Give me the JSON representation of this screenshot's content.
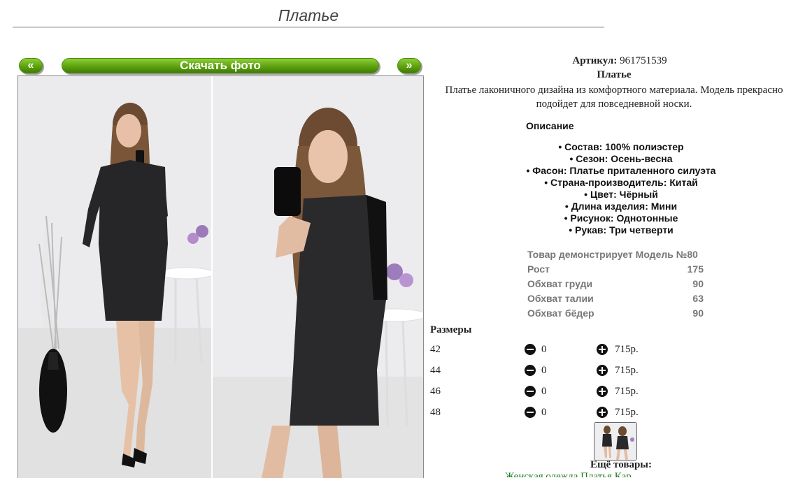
{
  "page": {
    "title": "Платье"
  },
  "gallery": {
    "prev_label": "«",
    "download_label": "Скачать фото",
    "next_label": "»"
  },
  "product": {
    "article_label": "Артикул:",
    "article_value": "961751539",
    "name": "Платье",
    "description": "Платье лаконичного дизайна из комфортного материала. Модель прекрасно подойдет для повседневной носки."
  },
  "specs": {
    "title": "Описание",
    "items": [
      "• Состав: 100% полиэстер",
      "• Сезон: Осень-весна",
      "• Фасон: Платье приталенного силуэта",
      "• Страна-производитель: Китай",
      "• Цвет: Чёрный",
      "• Длина изделия: Мини",
      "• Рисунок: Однотонные",
      "• Рукав: Три четверти"
    ]
  },
  "model": {
    "rows": [
      {
        "label": "Товар демонстрирует Модель №80",
        "value": ""
      },
      {
        "label": "Рост",
        "value": "175"
      },
      {
        "label": "Обхват груди",
        "value": "90"
      },
      {
        "label": "Обхват талии",
        "value": "63"
      },
      {
        "label": "Обхват бёдер",
        "value": "90"
      }
    ]
  },
  "sizes": {
    "title": "Размеры",
    "rows": [
      {
        "size": "42",
        "qty": "0",
        "price": "715р."
      },
      {
        "size": "44",
        "qty": "0",
        "price": "715р."
      },
      {
        "size": "46",
        "qty": "0",
        "price": "715р."
      },
      {
        "size": "48",
        "qty": "0",
        "price": "715р."
      }
    ]
  },
  "more": {
    "title": "Ещё товары:",
    "links_text": "Женская одежда Платья Кар"
  },
  "icons": {
    "minus": "minus-circle-icon",
    "plus": "plus-circle-icon"
  },
  "colors": {
    "button_green": "#5ea20e",
    "link_green": "#1b7a1b",
    "model_text": "#777777"
  }
}
